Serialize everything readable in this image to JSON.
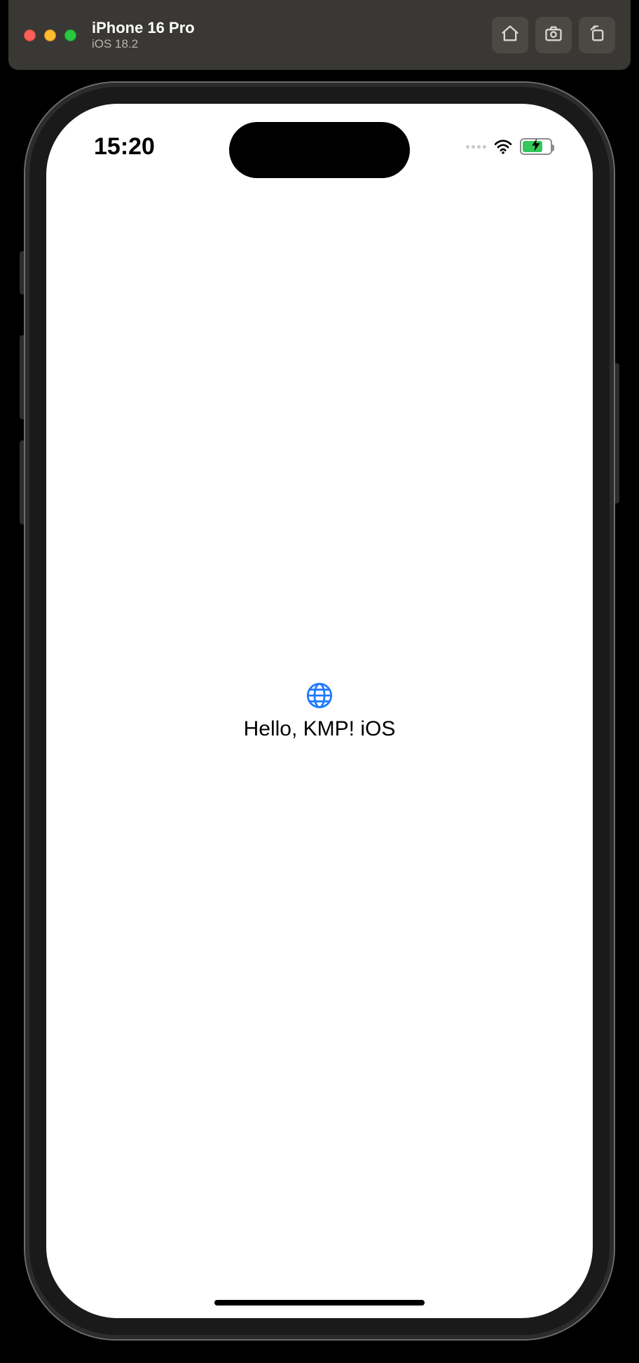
{
  "simulator": {
    "title": "iPhone 16 Pro",
    "subtitle": "iOS 18.2",
    "buttons": {
      "home": "home-icon",
      "screenshot": "screenshot-icon",
      "share": "share-icon"
    }
  },
  "status_bar": {
    "time": "15:20"
  },
  "app": {
    "greeting": "Hello, KMP! iOS"
  },
  "colors": {
    "accent": "#1f7bff",
    "battery_fill": "#34c759"
  }
}
